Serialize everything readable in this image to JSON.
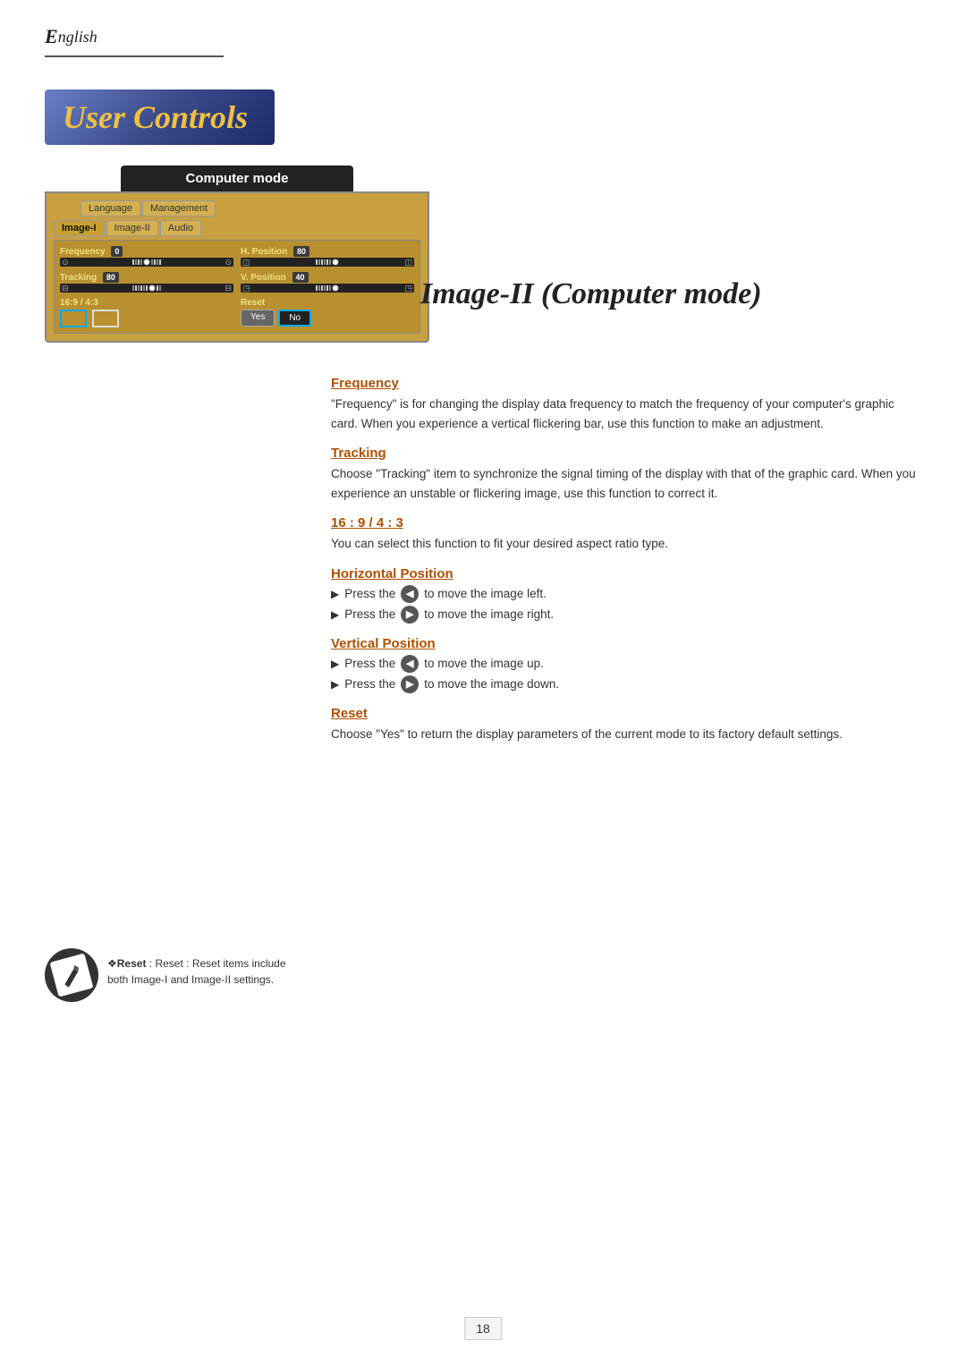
{
  "header": {
    "language_e": "E",
    "language_rest": "nglish"
  },
  "user_controls": {
    "title": "User Controls"
  },
  "computer_mode": {
    "title": "Computer mode",
    "tabs": [
      {
        "label": "Language",
        "active": false
      },
      {
        "label": "Management",
        "active": false
      },
      {
        "label": "Image-I",
        "active": false
      },
      {
        "label": "Image-II",
        "active": true
      },
      {
        "label": "Audio",
        "active": false
      }
    ],
    "params": {
      "frequency": {
        "label": "Frequency",
        "value": "0"
      },
      "tracking": {
        "label": "Tracking",
        "value": "80"
      },
      "h_position": {
        "label": "H. Position",
        "value": "80"
      },
      "v_position": {
        "label": "V. Position",
        "value": "40"
      },
      "aspect": {
        "label": "16:9 / 4:3"
      },
      "reset": {
        "label": "Reset",
        "yes": "Yes",
        "no": "No"
      }
    }
  },
  "page_title": "Image-II (Computer mode)",
  "sections": {
    "frequency": {
      "heading": "Frequency",
      "text": "\"Frequency\" is for changing the display data frequency to match the frequency of your computer's graphic card. When you experience a vertical flickering bar, use this function to make an adjustment."
    },
    "tracking": {
      "heading": "Tracking",
      "text": "Choose \"Tracking\" item to synchronize the signal timing of the display with that of the graphic card. When you experience an unstable or flickering image, use this function to correct it."
    },
    "aspect": {
      "heading": "16 : 9 / 4 : 3",
      "text": "You can select this function to fit your desired aspect ratio type."
    },
    "h_position": {
      "heading": "Horizontal Position",
      "bullet1": "Press the",
      "bullet1_end": "to move the image left.",
      "bullet2": "Press the",
      "bullet2_end": "to move the image right."
    },
    "v_position": {
      "heading": "Vertical Position",
      "bullet1": "Press the",
      "bullet1_end": "to move the image up.",
      "bullet2": "Press the",
      "bullet2_end": "to move the image down."
    },
    "reset": {
      "heading": "Reset",
      "text": "Choose \"Yes\" to return the display parameters of the current mode to its factory default settings."
    }
  },
  "note": {
    "label": "Reset",
    "text": "Reset : Reset items include both Image-I and Image-II settings."
  },
  "page_number": "18"
}
